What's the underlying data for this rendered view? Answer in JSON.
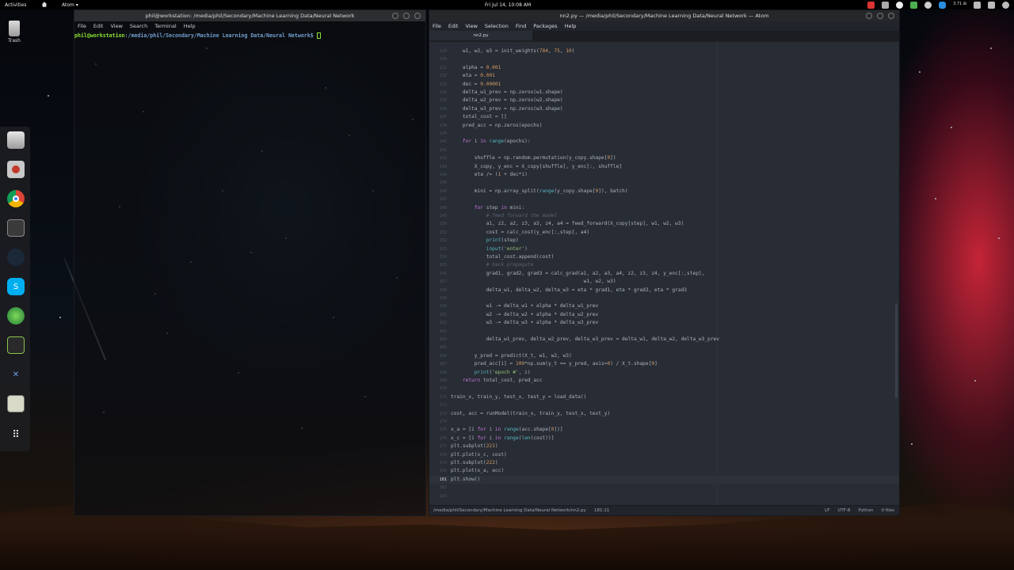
{
  "topbar": {
    "activities": "Activities",
    "app_menu": "Atom ▾",
    "clock": "Fri Jul 14, 10:08 AM",
    "net_speed": "3.71 ⊞"
  },
  "desktop": {
    "trash_label": "Trash"
  },
  "terminal": {
    "title": "phil@workstation: /media/phil/Secondary/Machine Learning Data/Neural Network",
    "menu": [
      "File",
      "Edit",
      "View",
      "Search",
      "Terminal",
      "Help"
    ],
    "prompt_user": "phil@workstation",
    "prompt_path": ":/media/phil/Secondary/Machine Learning Data/Neural Network$ "
  },
  "atom": {
    "title": "nn2.py — /media/phil/Secondary/Machine Learning Data/Neural Network — Atom",
    "menu": [
      "File",
      "Edit",
      "View",
      "Selection",
      "Find",
      "Packages",
      "Help"
    ],
    "tab": "nn2.py",
    "status": {
      "path": "/media/phil/Secondary/Machine Learning Data/Neural Network/nn2.py",
      "position": "181:11",
      "eol": "LF",
      "encoding": "UTF-8",
      "grammar": "Python",
      "files": "0 files"
    },
    "lines": [
      {
        "n": "129",
        "t": "    w1, w2, w3 = init_weights(784, 75, 10)"
      },
      {
        "n": "130",
        "t": ""
      },
      {
        "n": "131",
        "t": "    alpha = 0.001"
      },
      {
        "n": "132",
        "t": "    eta = 0.001"
      },
      {
        "n": "133",
        "t": "    dec = 0.00001"
      },
      {
        "n": "134",
        "t": "    delta_w1_prev = np.zeros(w1.shape)"
      },
      {
        "n": "135",
        "t": "    delta_w2_prev = np.zeros(w2.shape)"
      },
      {
        "n": "136",
        "t": "    delta_w3_prev = np.zeros(w3.shape)"
      },
      {
        "n": "137",
        "t": "    total_cost = []"
      },
      {
        "n": "138",
        "t": "    pred_acc = np.zeros(epochs)"
      },
      {
        "n": "139",
        "t": ""
      },
      {
        "n": "140",
        "t": "    for i in range(epochs):"
      },
      {
        "n": "141",
        "t": ""
      },
      {
        "n": "142",
        "t": "        shuffle = np.random.permutation(y_copy.shape[0])"
      },
      {
        "n": "143",
        "t": "        X_copy, y_enc = X_copy[shuffle], y_enc[:, shuffle]"
      },
      {
        "n": "144",
        "t": "        eta /= (1 + dec*i)"
      },
      {
        "n": "145",
        "t": ""
      },
      {
        "n": "146",
        "t": "        mini = np.array_split(range(y_copy.shape[0]), batch)"
      },
      {
        "n": "147",
        "t": ""
      },
      {
        "n": "148",
        "t": "        for step in mini:"
      },
      {
        "n": "149",
        "t": "            # feed forward the model"
      },
      {
        "n": "150",
        "t": "            a1, z2, a2, z3, a3, z4, a4 = feed_forward(X_copy[step], w1, w2, w3)"
      },
      {
        "n": "151",
        "t": "            cost = calc_cost(y_enc[:,step], a4)"
      },
      {
        "n": "152",
        "t": "            print(step)"
      },
      {
        "n": "153",
        "t": "            input('enter')"
      },
      {
        "n": "154",
        "t": "            total_cost.append(cost)"
      },
      {
        "n": "155",
        "t": "            # back propagate"
      },
      {
        "n": "156",
        "t": "            grad1, grad2, grad3 = calc_grad(a1, a2, a3, a4, z2, z3, z4, y_enc[:,step],"
      },
      {
        "n": "157",
        "t": "                                             w1, w2, w3)"
      },
      {
        "n": "158",
        "t": "            delta_w1, delta_w2, delta_w3 = eta * grad1, eta * grad2, eta * grad3"
      },
      {
        "n": "159",
        "t": ""
      },
      {
        "n": "160",
        "t": "            w1 -= delta_w1 + alpha * delta_w1_prev"
      },
      {
        "n": "161",
        "t": "            w2 -= delta_w2 + alpha * delta_w2_prev"
      },
      {
        "n": "162",
        "t": "            w3 -= delta_w3 + alpha * delta_w3_prev"
      },
      {
        "n": "163",
        "t": ""
      },
      {
        "n": "164",
        "t": "            delta_w1_prev, delta_w2_prev, delta_w3_prev = delta_w1, delta_w2, delta_w3_prev"
      },
      {
        "n": "165",
        "t": ""
      },
      {
        "n": "166",
        "t": "        y_pred = predict(X_t, w1, w2, w3)"
      },
      {
        "n": "167",
        "t": "        pred_acc[i] = 100*np.sum(y_t == y_pred, axis=0) / X_t.shape[0]"
      },
      {
        "n": "168",
        "t": "        print('epoch #', i)"
      },
      {
        "n": "169",
        "t": "    return total_cost, pred_acc"
      },
      {
        "n": "170",
        "t": ""
      },
      {
        "n": "171",
        "t": "train_x, train_y, test_x, test_y = load_data()"
      },
      {
        "n": "172",
        "t": ""
      },
      {
        "n": "173",
        "t": "cost, acc = runModel(train_x, train_y, test_x, test_y)"
      },
      {
        "n": "174",
        "t": ""
      },
      {
        "n": "175",
        "t": "x_a = [i for i in range(acc.shape[0])]"
      },
      {
        "n": "176",
        "t": "x_c = [i for i in range(len(cost))]"
      },
      {
        "n": "177",
        "t": "plt.subplot(221)"
      },
      {
        "n": "178",
        "t": "plt.plot(x_c, cost)"
      },
      {
        "n": "179",
        "t": "plt.subplot(222)"
      },
      {
        "n": "180",
        "t": "plt.plot(x_a, acc)"
      },
      {
        "n": "181",
        "t": "plt.show()"
      },
      {
        "n": "182",
        "t": ""
      },
      {
        "n": "183",
        "t": ""
      }
    ]
  },
  "colors": {
    "editor_bg": "#282c34",
    "keyword": "#c678dd",
    "number": "#d19a66",
    "string": "#98c379",
    "comment": "#5c6370",
    "prompt_user": "#8ae234",
    "prompt_path": "#729fcf"
  },
  "dock": [
    "files-icon",
    "camera-icon",
    "chrome-icon",
    "terminal-icon",
    "steam-icon",
    "skype-icon",
    "globe-icon",
    "system-monitor-icon",
    "tools-icon",
    "calculator-icon",
    "app-grid-icon"
  ]
}
